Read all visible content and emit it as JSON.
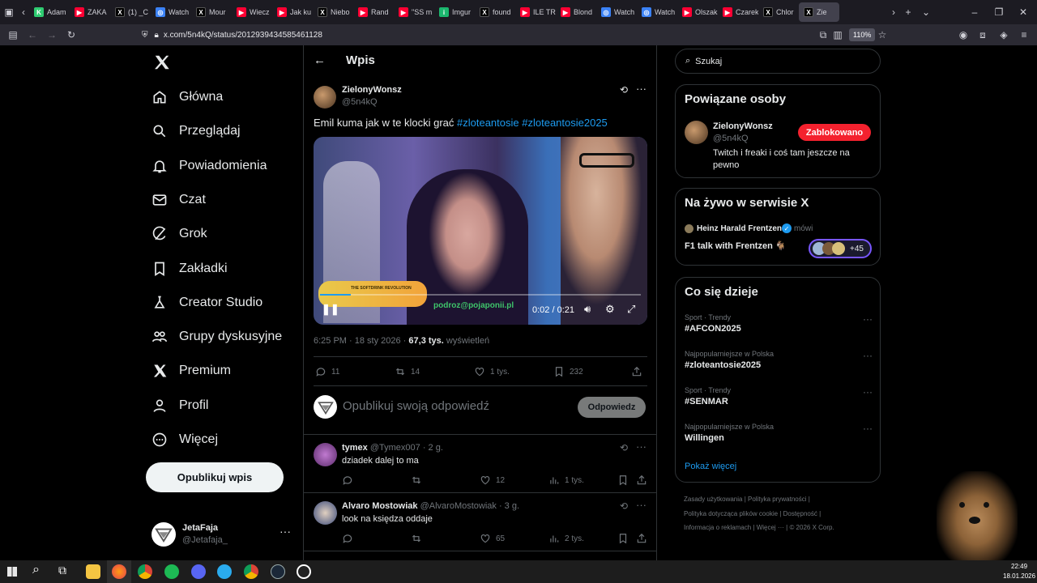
{
  "browser": {
    "tabs": [
      {
        "label": "Adam",
        "color": "#2ecc71",
        "glyph": "K"
      },
      {
        "label": "ZAKA",
        "color": "#ff0033",
        "glyph": "▶"
      },
      {
        "label": "(1) _C",
        "color": "#000000",
        "glyph": "X"
      },
      {
        "label": "Watch",
        "color": "#3b82f6",
        "glyph": "◎"
      },
      {
        "label": "Mour",
        "color": "#000000",
        "glyph": "X"
      },
      {
        "label": "Wiecz",
        "color": "#ff0033",
        "glyph": "▶"
      },
      {
        "label": "Jak ku",
        "color": "#ff0033",
        "glyph": "▶"
      },
      {
        "label": "Niebo",
        "color": "#000000",
        "glyph": "X"
      },
      {
        "label": "Rand",
        "color": "#ff0033",
        "glyph": "▶"
      },
      {
        "label": "\"SS m",
        "color": "#ff0033",
        "glyph": "▶"
      },
      {
        "label": "Imgur",
        "color": "#1bb76e",
        "glyph": "i"
      },
      {
        "label": "found",
        "color": "#000000",
        "glyph": "X"
      },
      {
        "label": "ILE TR",
        "color": "#ff0033",
        "glyph": "▶"
      },
      {
        "label": "Blond",
        "color": "#ff0033",
        "glyph": "▶"
      },
      {
        "label": "Watch",
        "color": "#3b82f6",
        "glyph": "◎"
      },
      {
        "label": "Watch",
        "color": "#3b82f6",
        "glyph": "◎"
      },
      {
        "label": "Olszak",
        "color": "#ff0033",
        "glyph": "▶"
      },
      {
        "label": "Czarek",
        "color": "#ff0033",
        "glyph": "▶"
      },
      {
        "label": "Chlor",
        "color": "#000000",
        "glyph": "X"
      },
      {
        "label": "Zie",
        "color": "#000000",
        "glyph": "X"
      }
    ],
    "url": "x.com/5n4kQ/status/2012939434585461128",
    "zoom": "110%"
  },
  "leftnav": {
    "items": [
      "Główna",
      "Przeglądaj",
      "Powiadomienia",
      "Czat",
      "Grok",
      "Zakładki",
      "Creator Studio",
      "Grupy dyskusyjne",
      "Premium",
      "Profil",
      "Więcej"
    ],
    "post_button": "Opublikuj wpis",
    "account_name": "JetaFaja",
    "account_handle": "@Jetafaja_"
  },
  "header": {
    "title": "Wpis"
  },
  "tweet": {
    "author": "ZielonyWonsz",
    "handle": "@5n4kQ",
    "text_prefix": "Emil kuma jak w te klocki grać ",
    "hashtag1": "#zloteantosie",
    "hashtag2": "#zloteantosie2025",
    "video_time": "0:02 / 0:21",
    "video_overlay_url": "podroz@pojaponii.pl",
    "video_overlay_title": "THE SOFTDRINK REVOLUTION",
    "timestamp": "6:25 PM · 18 sty 2026 ·",
    "views": "67,3 tys.",
    "views_label": "wyświetleń",
    "replies": "11",
    "reposts": "14",
    "likes": "1 tys.",
    "bookmarks": "232"
  },
  "composer": {
    "placeholder": "Opublikuj swoją odpowiedź",
    "reply_button": "Odpowiedz"
  },
  "replies": [
    {
      "name": "tymex",
      "handle": "@Tymex007 · 2 g.",
      "text": "dziadek dalej to ma",
      "likes": "12",
      "views": "1 tys."
    },
    {
      "name": "Alvaro Mostowiak",
      "handle": "@AlvaroMostowiak · 3 g.",
      "text": "look na księdza oddaje",
      "likes": "65",
      "views": "2 tys."
    }
  ],
  "right": {
    "search_placeholder": "Szukaj",
    "related_title": "Powiązane osoby",
    "related_name": "ZielonyWonsz",
    "related_handle": "@5n4kQ",
    "related_bio": "Twitch i freaki i coś tam jeszcze na pewno",
    "blocked_label": "Zablokowano",
    "live_title": "Na żywo w serwisie X",
    "live_host": "Heinz Harald Frentzen",
    "live_status": "mówi",
    "live_topic": "F1 talk with Frentzen 🐐",
    "live_count": "+45",
    "trends_title": "Co się dzieje",
    "trends": [
      {
        "context": "Sport · Trendy",
        "topic": "#AFCON2025"
      },
      {
        "context": "Najpopularniejsze w Polska",
        "topic": "#zloteantosie2025"
      },
      {
        "context": "Sport · Trendy",
        "topic": "#SENMAR"
      },
      {
        "context": "Najpopularniejsze w Polska",
        "topic": "Willingen"
      }
    ],
    "show_more": "Pokaż więcej",
    "footer": [
      "Zasady użytkowania",
      "Polityka prywatności",
      "Polityka dotycząca plików cookie",
      "Dostępność",
      "Informacja o reklamach",
      "Więcej ···",
      "© 2026 X Corp."
    ]
  },
  "taskbar": {
    "time": "22:49",
    "date": "18.01.2026"
  },
  "colors": {
    "accent": "#1d9bf0",
    "blocked": "#f4212e",
    "bg": "#000000",
    "border": "#2f3336"
  }
}
